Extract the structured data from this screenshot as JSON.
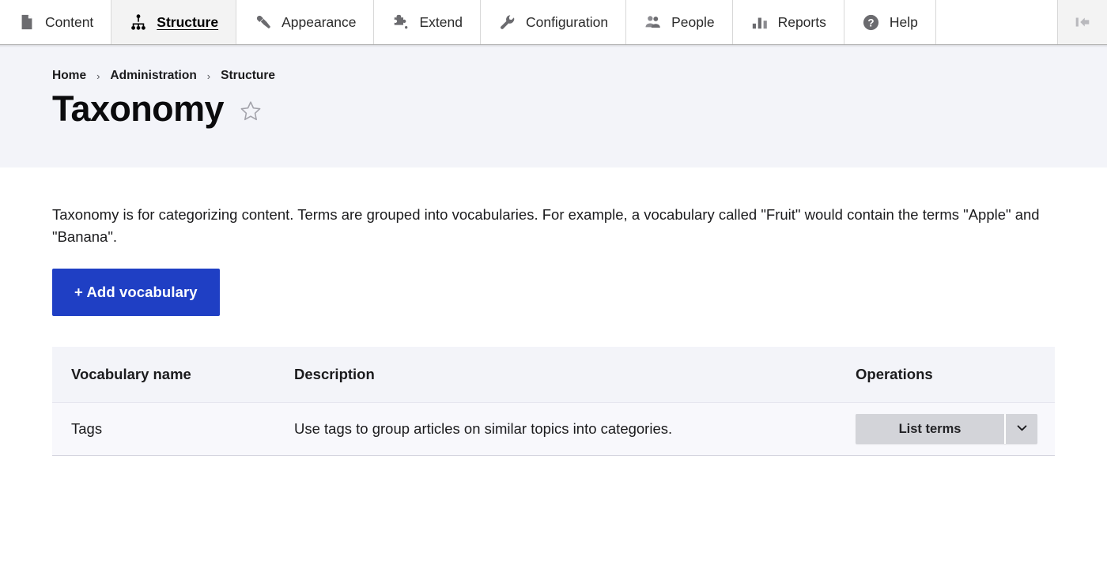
{
  "toolbar": {
    "items": [
      {
        "label": "Content",
        "icon": "content-page-icon",
        "active": false
      },
      {
        "label": "Structure",
        "icon": "structure-tree-icon",
        "active": true
      },
      {
        "label": "Appearance",
        "icon": "paintbrush-icon",
        "active": false
      },
      {
        "label": "Extend",
        "icon": "puzzle-piece-icon",
        "active": false
      },
      {
        "label": "Configuration",
        "icon": "wrench-icon",
        "active": false
      },
      {
        "label": "People",
        "icon": "people-icon",
        "active": false
      },
      {
        "label": "Reports",
        "icon": "bar-chart-icon",
        "active": false
      },
      {
        "label": "Help",
        "icon": "question-mark-icon",
        "active": false
      }
    ],
    "collapse_icon": "collapse-left-icon"
  },
  "breadcrumb": {
    "items": [
      "Home",
      "Administration",
      "Structure"
    ],
    "separator": "›"
  },
  "page": {
    "title": "Taxonomy",
    "star_icon": "star-outline-icon",
    "intro": "Taxonomy is for categorizing content. Terms are grouped into vocabularies. For example, a vocabulary called \"Fruit\" would contain the terms \"Apple\" and \"Banana\".",
    "add_button": "+ Add vocabulary"
  },
  "table": {
    "headers": [
      "Vocabulary name",
      "Description",
      "Operations"
    ],
    "rows": [
      {
        "name": "Tags",
        "description": "Use tags to group articles on similar topics into categories.",
        "operation": "List terms",
        "toggle_icon": "chevron-down-icon"
      }
    ]
  },
  "colors": {
    "primary_button": "#1f3fc4",
    "hero_background": "#f3f4f9",
    "table_header": "#f3f4f9",
    "table_row": "#f8f8fc",
    "dropbutton": "#d3d4d9"
  }
}
